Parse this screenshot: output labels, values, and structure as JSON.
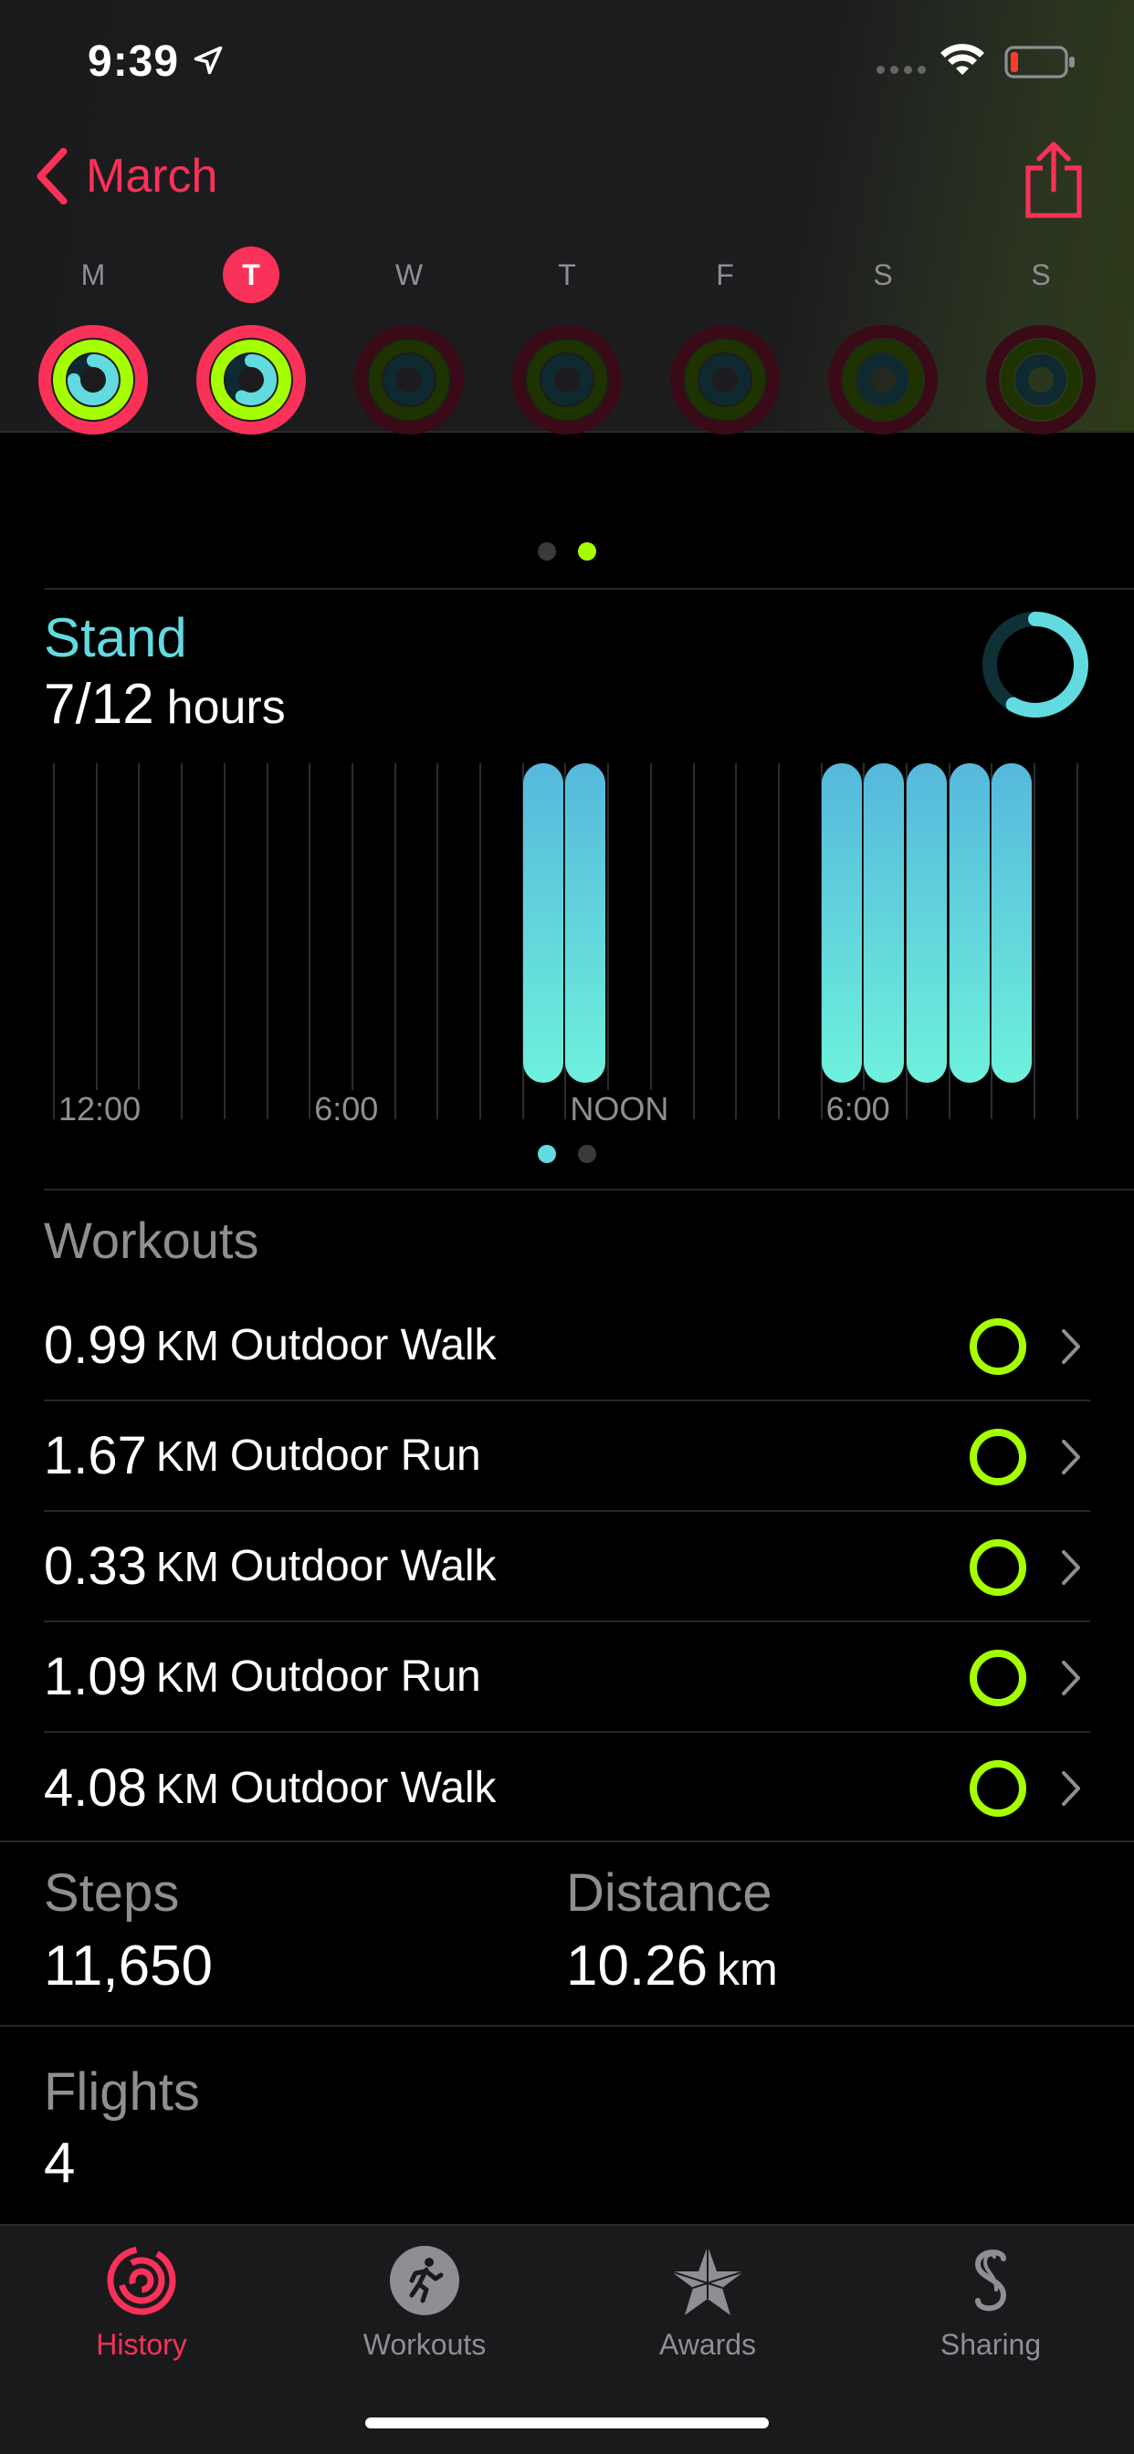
{
  "status_bar": {
    "time": "9:39"
  },
  "nav": {
    "back_label": "March"
  },
  "week": [
    {
      "letter": "M",
      "state": "done"
    },
    {
      "letter": "T",
      "state": "selected"
    },
    {
      "letter": "W",
      "state": "empty"
    },
    {
      "letter": "T",
      "state": "empty"
    },
    {
      "letter": "F",
      "state": "empty"
    },
    {
      "letter": "S",
      "state": "empty"
    },
    {
      "letter": "S",
      "state": "empty"
    }
  ],
  "stand": {
    "title": "Stand",
    "value": "7/12",
    "unit": "hours",
    "progress": 0.58,
    "ticks": [
      "12:00",
      "6:00",
      "NOON",
      "6:00"
    ],
    "hours_stood": [
      11,
      12,
      18,
      19,
      20,
      21,
      22
    ]
  },
  "workouts": {
    "title": "Workouts",
    "items": [
      {
        "distance": "0.99",
        "unit": "KM",
        "name": "Outdoor Walk"
      },
      {
        "distance": "1.67",
        "unit": "KM",
        "name": "Outdoor Run"
      },
      {
        "distance": "0.33",
        "unit": "KM",
        "name": "Outdoor Walk"
      },
      {
        "distance": "1.09",
        "unit": "KM",
        "name": "Outdoor Run"
      },
      {
        "distance": "4.08",
        "unit": "KM",
        "name": "Outdoor Walk"
      }
    ]
  },
  "stats": {
    "steps_label": "Steps",
    "steps_value": "11,650",
    "distance_label": "Distance",
    "distance_value": "10.26",
    "distance_unit": "km",
    "flights_label": "Flights",
    "flights_value": "4"
  },
  "tabbar": {
    "history": "History",
    "workouts": "Workouts",
    "awards": "Awards",
    "sharing": "Sharing"
  },
  "colors": {
    "accent": "#fa3158",
    "move": "#fa3158",
    "exercise": "#a6ff00",
    "stand": "#62dbe0"
  }
}
